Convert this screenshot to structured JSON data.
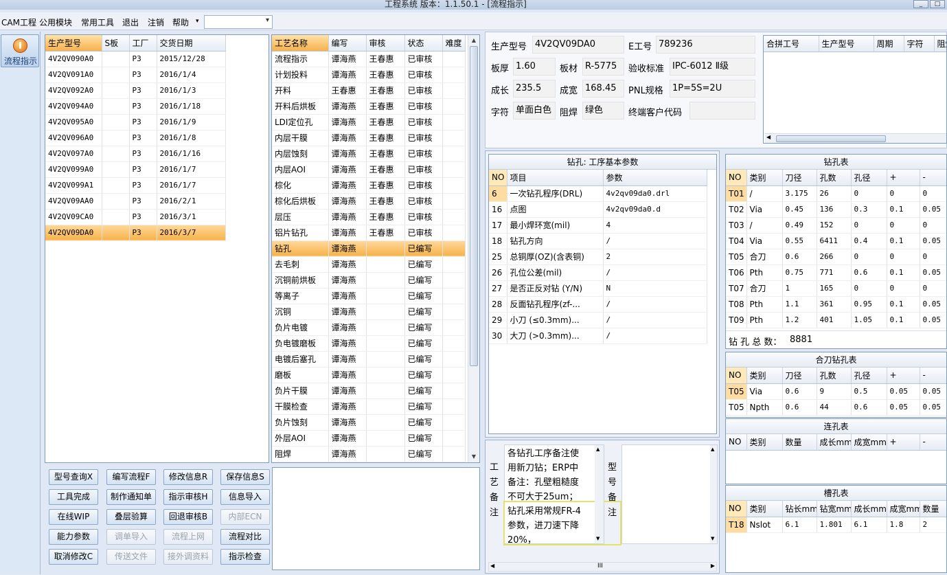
{
  "window": {
    "title": "工程系统  版本：1.1.50.1 - [流程指示]",
    "btn_min": "_",
    "btn_max": "□"
  },
  "menu": {
    "items": [
      "CAM工程",
      "公用模块",
      "常用工具",
      "退出",
      "注销",
      "帮助"
    ],
    "help_arrow": "▾",
    "combo_value": ""
  },
  "nav": {
    "flow_label": "流程指示"
  },
  "orders": {
    "headers": [
      "生产型号",
      "S板",
      "工厂",
      "交货日期"
    ],
    "rows": [
      [
        "4V2QV090A0",
        "",
        "P3",
        "2015/12/28"
      ],
      [
        "4V2QV091A0",
        "",
        "P3",
        "2016/1/4"
      ],
      [
        "4V2QV092A0",
        "",
        "P3",
        "2016/1/3"
      ],
      [
        "4V2QV094A0",
        "",
        "P3",
        "2016/1/18"
      ],
      [
        "4V2QV095A0",
        "",
        "P3",
        "2016/1/9"
      ],
      [
        "4V2QV096A0",
        "",
        "P3",
        "2016/1/8"
      ],
      [
        "4V2QV097A0",
        "",
        "P3",
        "2016/1/16"
      ],
      [
        "4V2QV099A0",
        "",
        "P3",
        "2016/1/7"
      ],
      [
        "4V2QV099A1",
        "",
        "P3",
        "2016/1/7"
      ],
      [
        "4V2QV09AA0",
        "",
        "P3",
        "2016/2/1"
      ],
      [
        "4V2QV09CA0",
        "",
        "P3",
        "2016/3/1"
      ],
      [
        "4V2QV09DA0",
        "",
        "P3",
        "2016/3/7"
      ]
    ],
    "selected": 11
  },
  "process": {
    "headers": [
      "工艺名称",
      "编写",
      "审核",
      "状态",
      "难度"
    ],
    "rows": [
      [
        "流程指示",
        "谭海燕",
        "王春惠",
        "已审核",
        ""
      ],
      [
        "计划投料",
        "谭海燕",
        "王春惠",
        "已审核",
        ""
      ],
      [
        "开料",
        "王春惠",
        "王春惠",
        "已审核",
        ""
      ],
      [
        "开料后烘板",
        "谭海燕",
        "王春惠",
        "已审核",
        ""
      ],
      [
        "LDI定位孔",
        "谭海燕",
        "王春惠",
        "已审核",
        ""
      ],
      [
        "内层干膜",
        "谭海燕",
        "王春惠",
        "已审核",
        ""
      ],
      [
        "内层蚀刻",
        "谭海燕",
        "王春惠",
        "已审核",
        ""
      ],
      [
        "内层AOI",
        "谭海燕",
        "王春惠",
        "已审核",
        ""
      ],
      [
        "棕化",
        "谭海燕",
        "王春惠",
        "已审核",
        ""
      ],
      [
        "棕化后烘板",
        "谭海燕",
        "王春惠",
        "已审核",
        ""
      ],
      [
        "层压",
        "谭海燕",
        "王春惠",
        "已审核",
        ""
      ],
      [
        "铝片钻孔",
        "谭海燕",
        "王春惠",
        "已审核",
        ""
      ],
      [
        "钻孔",
        "谭海燕",
        "",
        "已编写",
        ""
      ],
      [
        "去毛刺",
        "谭海燕",
        "",
        "已编写",
        ""
      ],
      [
        "沉铜前烘板",
        "谭海燕",
        "",
        "已编写",
        ""
      ],
      [
        "等离子",
        "谭海燕",
        "",
        "已编写",
        ""
      ],
      [
        "沉铜",
        "谭海燕",
        "",
        "已编写",
        ""
      ],
      [
        "负片电镀",
        "谭海燕",
        "",
        "已编写",
        ""
      ],
      [
        "负电镀磨板",
        "谭海燕",
        "",
        "已编写",
        ""
      ],
      [
        "电镀后塞孔",
        "谭海燕",
        "",
        "已编写",
        ""
      ],
      [
        "磨板",
        "谭海燕",
        "",
        "已编写",
        ""
      ],
      [
        "负片干膜",
        "谭海燕",
        "",
        "已编写",
        ""
      ],
      [
        "干膜检查",
        "谭海燕",
        "",
        "已编写",
        ""
      ],
      [
        "负片蚀刻",
        "谭海燕",
        "",
        "已编写",
        ""
      ],
      [
        "外层AOI",
        "谭海燕",
        "",
        "已编写",
        ""
      ],
      [
        "阻焊",
        "谭海燕",
        "",
        "已编写",
        ""
      ]
    ],
    "selected": 12
  },
  "buttons": [
    [
      "型号查询X",
      "编写流程F",
      "修改信息R",
      "保存信息S"
    ],
    [
      "工具完成",
      "制作通知单",
      "指示审核H",
      "信息导入"
    ],
    [
      "在线WIP",
      "叠层验算",
      "回退审核B",
      "内部ECN"
    ],
    [
      "能力参数",
      "调单导入",
      "流程上网",
      "流程对比"
    ],
    [
      "取消修改C",
      "传送文件",
      "接外调资料",
      "指示检查"
    ]
  ],
  "buttons_disabled": [
    [
      false,
      false,
      false,
      false
    ],
    [
      false,
      false,
      false,
      false
    ],
    [
      false,
      false,
      false,
      true
    ],
    [
      false,
      true,
      true,
      false
    ],
    [
      false,
      true,
      true,
      false
    ]
  ],
  "info": {
    "model_label": "生产型号",
    "model": "4V2QV09DA0",
    "e_label": "E工号",
    "e_no": "789236",
    "thick_label": "板厚",
    "thick": "1.60",
    "mat_label": "板材",
    "mat": "R-5775",
    "std_label": "验收标准",
    "std": "IPC-6012 Ⅱ级",
    "len_label": "成长",
    "len": "235.5",
    "wid_label": "成宽",
    "wid": "168.45",
    "pnl_label": "PNL规格",
    "pnl": "1P=5S=2U",
    "char_label": "字符",
    "char": "单面白色",
    "mask_label": "阻焊",
    "mask": "绿色",
    "cust_label": "终端客户代码",
    "cust": ""
  },
  "combine": {
    "headers": [
      "合拼工号",
      "生产型号",
      "周期",
      "字符",
      "阻焊"
    ]
  },
  "drill_params": {
    "title": "钻孔: 工序基本参数",
    "headers": [
      "NO",
      "项目",
      "参数"
    ],
    "rows": [
      [
        "6",
        "一次钻孔程序(DRL)",
        "4v2qv09da0.drl"
      ],
      [
        "16",
        "点图",
        "4v2qv09da0.d"
      ],
      [
        "17",
        "最小焊环宽(mil)",
        "4"
      ],
      [
        "18",
        "钻孔方向",
        "/"
      ],
      [
        "25",
        "总铜厚(OZ)(含表铜)",
        "2"
      ],
      [
        "26",
        "孔位公差(mil)",
        "/"
      ],
      [
        "27",
        "是否正反对钻 (Y/N)",
        "N"
      ],
      [
        "28",
        "反面钻孔程序(zf-...",
        "/"
      ],
      [
        "29",
        "小刀 (≤0.3mm)...",
        "/"
      ],
      [
        "30",
        "大刀 (>0.3mm)...",
        "/"
      ]
    ]
  },
  "drill_table": {
    "title": "钻孔表",
    "headers": [
      "NO",
      "类别",
      "刀径",
      "孔数",
      "孔径",
      "+",
      "-"
    ],
    "rows": [
      [
        "T01",
        "/",
        "3.175",
        "26",
        "0",
        "0",
        "0"
      ],
      [
        "T02",
        "Via",
        "0.45",
        "136",
        "0.3",
        "0.1",
        "0.05"
      ],
      [
        "T03",
        "/",
        "0.49",
        "152",
        "0",
        "0",
        "0"
      ],
      [
        "T04",
        "Via",
        "0.55",
        "6411",
        "0.4",
        "0.1",
        "0.05"
      ],
      [
        "T05",
        "合刀",
        "0.6",
        "266",
        "0",
        "0",
        "0"
      ],
      [
        "T06",
        "Pth",
        "0.75",
        "771",
        "0.6",
        "0.1",
        "0.05"
      ],
      [
        "T07",
        "合刀",
        "1",
        "165",
        "0",
        "0",
        "0"
      ],
      [
        "T08",
        "Pth",
        "1.1",
        "361",
        "0.95",
        "0.1",
        "0.05"
      ],
      [
        "T09",
        "Pth",
        "1.2",
        "401",
        "1.05",
        "0.1",
        "0.05"
      ]
    ],
    "total_label": "钻 孔 总 数：",
    "total": "8881"
  },
  "merge_table": {
    "title": "合刀钻孔表",
    "headers": [
      "NO",
      "类别",
      "刀径",
      "孔数",
      "孔径",
      "+",
      "-"
    ],
    "rows": [
      [
        "T05",
        "Via",
        "0.6",
        "9",
        "0.5",
        "0.05",
        "0.05"
      ],
      [
        "T05",
        "Npth",
        "0.6",
        "44",
        "0.6",
        "0.05",
        "0.05"
      ]
    ]
  },
  "link_table": {
    "title": "连孔表",
    "headers": [
      "NO",
      "类别",
      "数量",
      "成长mm",
      "成宽mm",
      "+",
      "-"
    ]
  },
  "slot_table": {
    "title": "槽孔表",
    "headers": [
      "NO",
      "类别",
      "钻长mm",
      "钻宽mm",
      "成长mm",
      "成宽mm",
      "数量"
    ],
    "rows": [
      [
        "T18",
        "Nslot",
        "6.1",
        "1.801",
        "6.1",
        "1.8",
        "2"
      ]
    ]
  },
  "notes": {
    "proc_label": [
      "工",
      "艺",
      "备",
      "注"
    ],
    "proc_note": [
      "各钻孔工序备注使",
      "用新刀钻；ERP中",
      "备注：孔壁粗糙度",
      "不可大于25um；",
      "钻孔采用常规FR-4",
      "参数，进刀速下降",
      "20%，"
    ],
    "model_label": [
      "型",
      "号",
      "备",
      "注"
    ],
    "model_note": "",
    "scroll_mid": "III"
  }
}
